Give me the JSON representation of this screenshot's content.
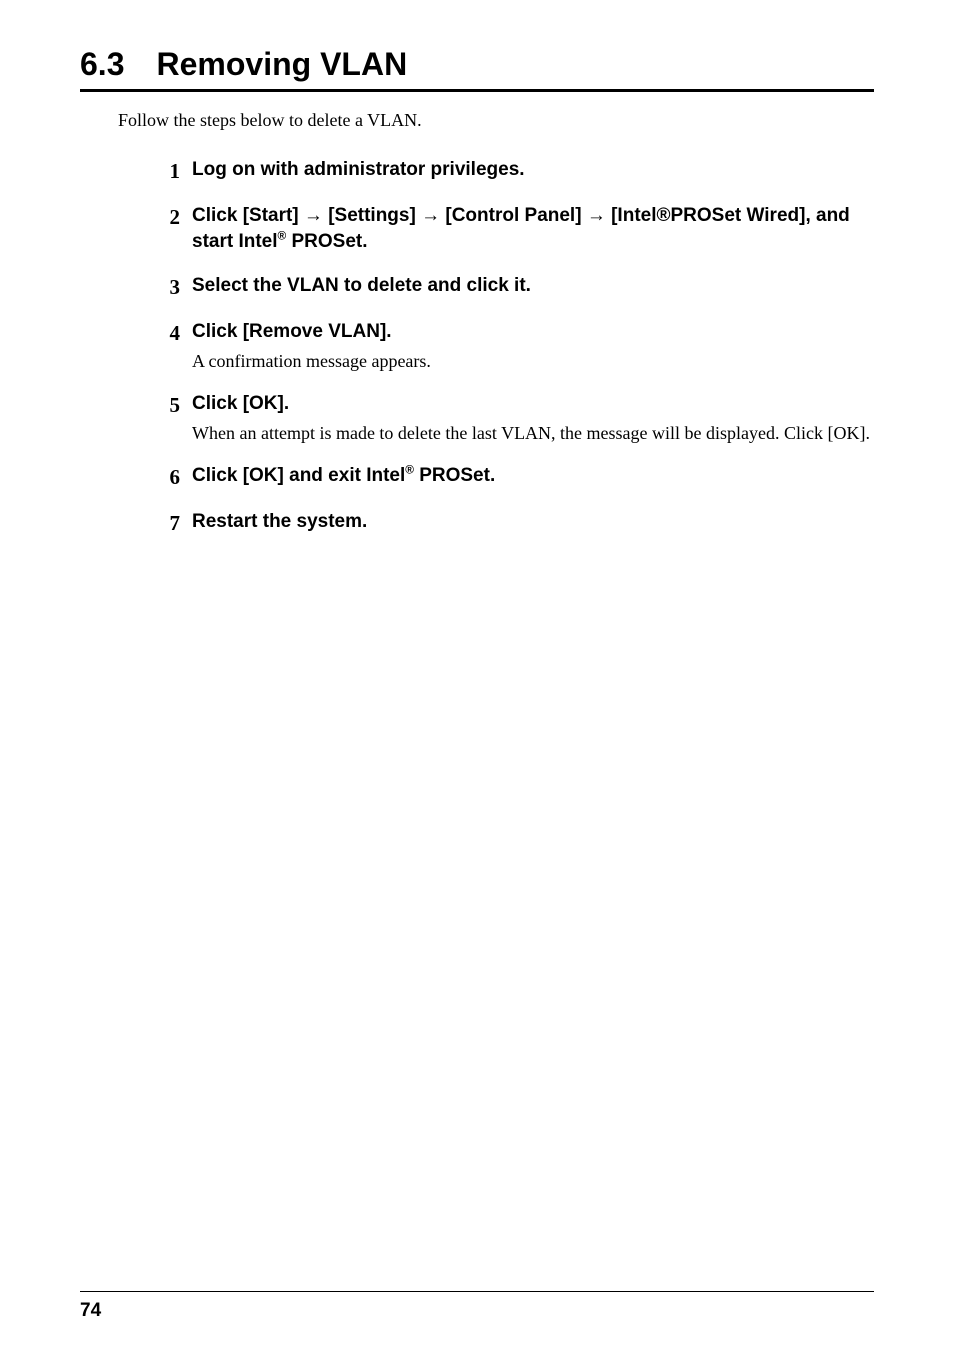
{
  "section": {
    "number": "6.3",
    "title": "Removing VLAN"
  },
  "intro": "Follow the steps below to delete a VLAN.",
  "steps": [
    {
      "num": "1",
      "title_html": "Log on with administrator privileges.",
      "body": ""
    },
    {
      "num": "2",
      "title_html": "Click [Start] <span class=\"arrow\">→</span> [Settings] <span class=\"arrow\">→</span> [Control Panel] <span class=\"arrow\">→</span> [Intel®PROSet Wired], and start Intel<sup class=\"reg\">®</sup> PROSet.",
      "body": ""
    },
    {
      "num": "3",
      "title_html": "Select the VLAN to delete and click it.",
      "body": ""
    },
    {
      "num": "4",
      "title_html": "Click [Remove VLAN].",
      "body": "A confirmation message appears."
    },
    {
      "num": "5",
      "title_html": "Click [OK].",
      "body": "When an attempt is made to delete the last VLAN, the message will be displayed. Click [OK]."
    },
    {
      "num": "6",
      "title_html": "Click [OK] and exit Intel<sup class=\"reg\">®</sup> PROSet.",
      "body": ""
    },
    {
      "num": "7",
      "title_html": "Restart the system.",
      "body": ""
    }
  ],
  "page_number": "74"
}
